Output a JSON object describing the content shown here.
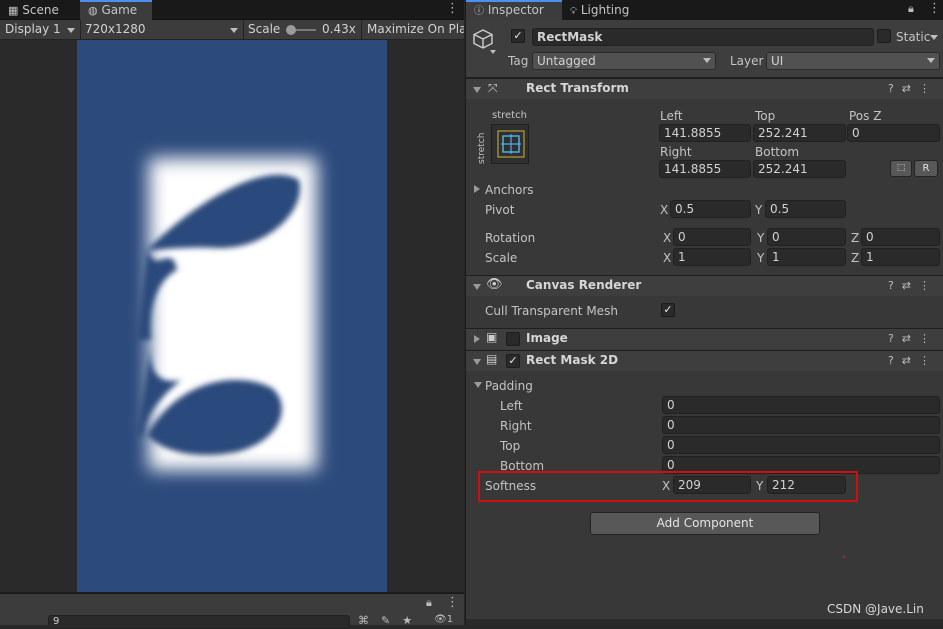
{
  "left_panel": {
    "tabs": [
      {
        "label": "Scene",
        "icon": "scene-grid-icon"
      },
      {
        "label": "Game",
        "icon": "gamepad-icon"
      }
    ],
    "toolbar": {
      "display": "Display 1",
      "resolution": "720x1280",
      "scale_label": "Scale",
      "scale_value": "0.43x",
      "maximize": "Maximize On Play"
    },
    "bottom_search_value": "9"
  },
  "inspector": {
    "tabs": [
      {
        "label": "Inspector",
        "icon": "info-icon"
      },
      {
        "label": "Lighting",
        "icon": "lightbulb-icon"
      }
    ],
    "object": {
      "name": "RectMask",
      "static_label": "Static",
      "tag_label": "Tag",
      "tag_value": "Untagged",
      "layer_label": "Layer",
      "layer_value": "UI"
    },
    "rect_transform": {
      "title": "Rect Transform",
      "anchor_preset": "stretch",
      "fields": {
        "left_label": "Left",
        "left": "141.8855",
        "top_label": "Top",
        "top": "252.241",
        "posz_label": "Pos Z",
        "posz": "0",
        "right_label": "Right",
        "right": "141.8855",
        "bottom_label": "Bottom",
        "bottom": "252.241"
      },
      "r_button": "R",
      "anchors_label": "Anchors",
      "pivot_label": "Pivot",
      "pivot_x": "0.5",
      "pivot_y": "0.5",
      "rotation_label": "Rotation",
      "rot_x": "0",
      "rot_y": "0",
      "rot_z": "0",
      "scale_label": "Scale",
      "scale_x": "1",
      "scale_y": "1",
      "scale_z": "1"
    },
    "canvas_renderer": {
      "title": "Canvas Renderer",
      "cull_label": "Cull Transparent Mesh"
    },
    "image": {
      "title": "Image"
    },
    "rect_mask": {
      "title": "Rect Mask 2D",
      "padding_label": "Padding",
      "left_label": "Left",
      "left": "0",
      "right_label": "Right",
      "right": "0",
      "top_label": "Top",
      "top": "0",
      "bottom_label": "Bottom",
      "bottom": "0",
      "softness_label": "Softness",
      "softness_x": "209",
      "softness_y": "212"
    },
    "add_component": "Add Component",
    "watermark": "CSDN @Jave.Lin"
  },
  "axis_labels": {
    "x": "X",
    "y": "Y",
    "z": "Z"
  },
  "colors": {
    "highlight_box": "#d01010",
    "game_background": "#2c4a7c",
    "accent_tab": "#4d90f0"
  }
}
